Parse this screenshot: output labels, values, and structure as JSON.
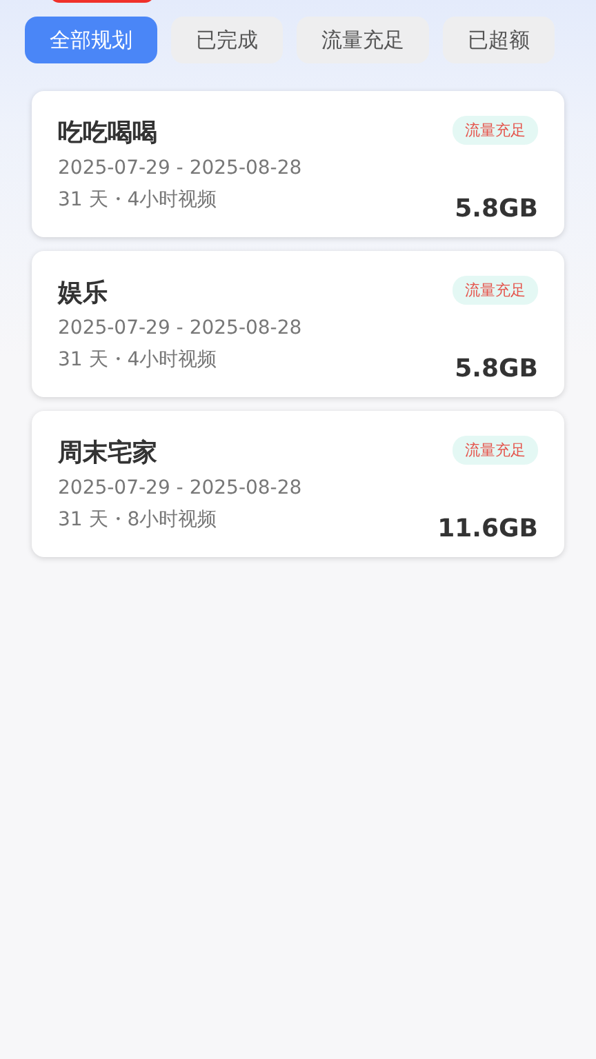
{
  "tabs": [
    {
      "label": "全部规划",
      "selected": true
    },
    {
      "label": "已完成",
      "selected": false
    },
    {
      "label": "流量充足",
      "selected": false
    },
    {
      "label": "已超额",
      "selected": false
    }
  ],
  "plans": [
    {
      "name": "吃吃喝喝",
      "status": "流量充足",
      "dates": "2025-07-29 - 2025-08-28",
      "detail": "31 天・4小时视频",
      "amount": "5.8GB"
    },
    {
      "name": "娱乐",
      "status": "流量充足",
      "dates": "2025-07-29 - 2025-08-28",
      "detail": "31 天・4小时视频",
      "amount": "5.8GB"
    },
    {
      "name": "周末宅家",
      "status": "流量充足",
      "dates": "2025-07-29 - 2025-08-28",
      "detail": "31 天・8小时视频",
      "amount": "11.6GB"
    }
  ]
}
